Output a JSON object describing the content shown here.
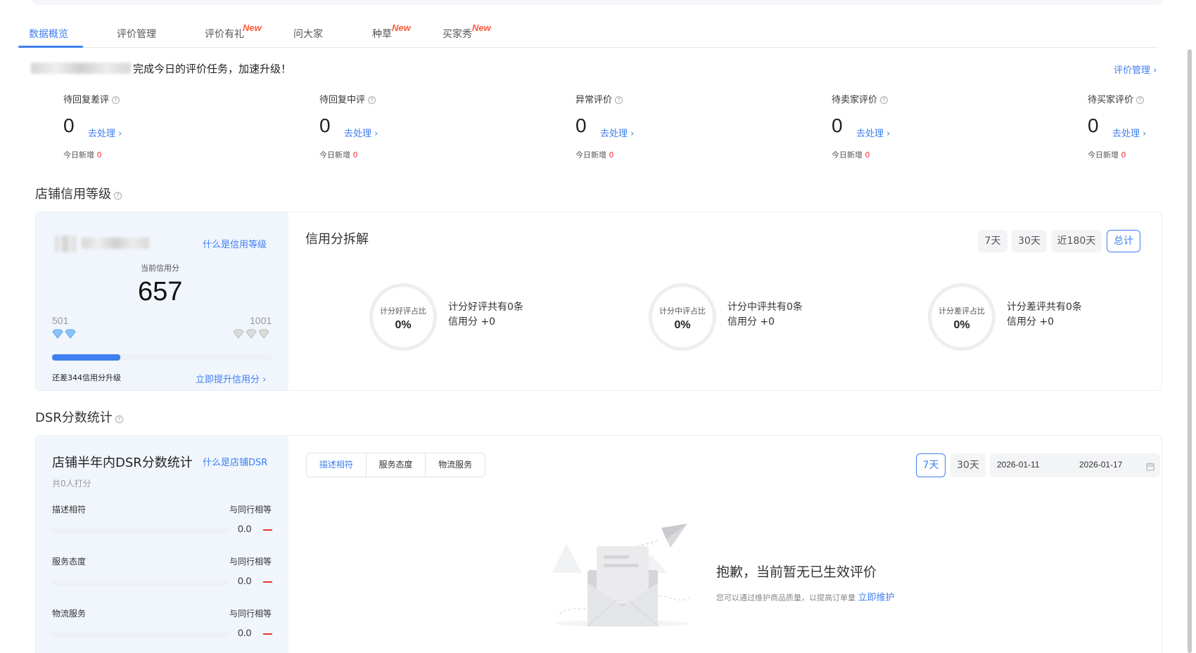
{
  "tabs": [
    {
      "label": "数据概览",
      "new": ""
    },
    {
      "label": "评价管理",
      "new": ""
    },
    {
      "label": "评价有礼",
      "new": "New"
    },
    {
      "label": "问大家",
      "new": ""
    },
    {
      "label": "种草",
      "new": "New"
    },
    {
      "label": "买家秀",
      "new": "New"
    }
  ],
  "banner": {
    "text": "完成今日的评价任务，加速升级！",
    "manage_link": "评价管理 ›"
  },
  "stats": [
    {
      "label": "待回复差评",
      "value": "0",
      "action": "去处理 ›",
      "today_label": "今日新增",
      "today_value": "0"
    },
    {
      "label": "待回复中评",
      "value": "0",
      "action": "去处理 ›",
      "today_label": "今日新增",
      "today_value": "0"
    },
    {
      "label": "异常评价",
      "value": "0",
      "action": "去处理 ›",
      "today_label": "今日新增",
      "today_value": "0"
    },
    {
      "label": "待卖家评价",
      "value": "0",
      "action": "去处理 ›",
      "today_label": "今日新增",
      "today_value": "0"
    },
    {
      "label": "待买家评价",
      "value": "0",
      "action": "去处理 ›",
      "today_label": "今日新增",
      "today_value": "0"
    }
  ],
  "credit": {
    "section_title": "店铺信用等级",
    "what_link": "什么是信用等级",
    "current_label": "当前信用分",
    "current_value": "657",
    "min": "501",
    "max": "1001",
    "progress": 0.31,
    "upgrade_text": "还差344信用分升级",
    "boost_link": "立即提升信用分 ›"
  },
  "breakdown": {
    "title": "信用分拆解",
    "ranges": [
      "7天",
      "30天",
      "近180天",
      "总计"
    ],
    "active_range": "总计",
    "items": [
      {
        "ring_label": "计分好评占比",
        "ring_value": "0%",
        "line1": "计分好评共有0条",
        "line2": "信用分 +0"
      },
      {
        "ring_label": "计分中评占比",
        "ring_value": "0%",
        "line1": "计分中评共有0条",
        "line2": "信用分 +0"
      },
      {
        "ring_label": "计分差评占比",
        "ring_value": "0%",
        "line1": "计分差评共有0条",
        "line2": "信用分 +0"
      }
    ]
  },
  "dsr": {
    "section_title": "DSR分数统计",
    "card_title": "店铺半年内DSR分数统计",
    "what_link": "什么是店铺DSR",
    "raters": "共0人打分",
    "rows": [
      {
        "label": "描述相符",
        "compare": "与同行相等",
        "value": "0.0"
      },
      {
        "label": "服务态度",
        "compare": "与同行相等",
        "value": "0.0"
      },
      {
        "label": "物流服务",
        "compare": "与同行相等",
        "value": "0.0"
      }
    ],
    "tabs": [
      "描述相符",
      "服务态度",
      "物流服务"
    ],
    "ranges": [
      "7天",
      "30天"
    ],
    "date_start": "2026-01-11",
    "date_end": "2026-01-17",
    "empty_title": "抱歉，当前暂无已生效评价",
    "empty_desc": "您可以通过维护商品质量，以提高订单量",
    "empty_link": "立即维护"
  },
  "colors": {
    "accent": "#3f7ff0",
    "new_badge": "#ff5b3a",
    "warning": "#ee3333"
  }
}
